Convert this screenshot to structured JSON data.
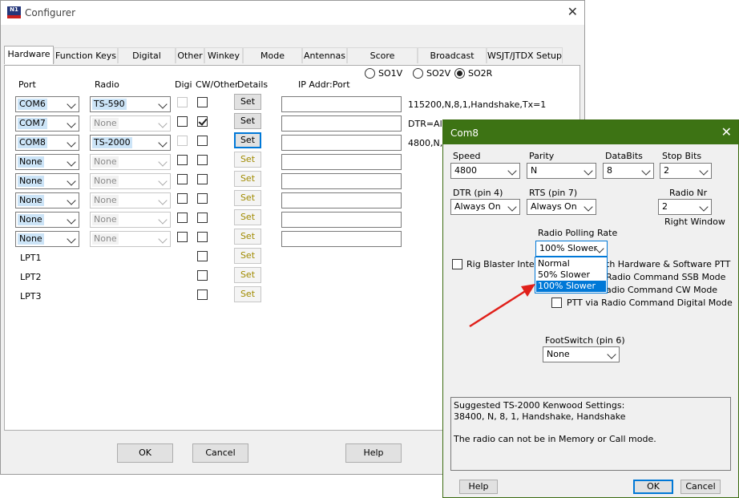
{
  "main_window": {
    "title": "Configurer",
    "tabs": [
      "Hardware",
      "Function Keys",
      "Digital Modes",
      "Other",
      "Winkey",
      "Mode Control",
      "Antennas",
      "Score Reporting",
      "Broadcast Data",
      "WSJT/JTDX Setup"
    ],
    "active_tab": "Hardware",
    "so_options": [
      "SO1V",
      "SO2V",
      "SO2R"
    ],
    "so_selected": "SO2R",
    "headers": {
      "port": "Port",
      "radio": "Radio",
      "digi": "Digi",
      "cw_other": "CW/Other",
      "details": "Details",
      "ip_addr": "IP Addr:Port"
    },
    "rows": [
      {
        "port": "COM6",
        "radio": "TS-590",
        "radio_enabled": true,
        "digi_enabled": false,
        "digi": false,
        "cw": false,
        "set_enabled": true,
        "info": "115200,N,8,1,Handshake,Tx=1"
      },
      {
        "port": "COM7",
        "radio": "None",
        "radio_enabled": false,
        "digi_enabled": true,
        "digi": false,
        "cw": true,
        "set_enabled": true,
        "info": "DTR=Alw"
      },
      {
        "port": "COM8",
        "radio": "TS-2000",
        "radio_enabled": true,
        "digi_enabled": false,
        "digi": false,
        "cw": false,
        "set_enabled": true,
        "set_focused": true,
        "info": "4800,N,8,"
      },
      {
        "port": "None",
        "radio": "None",
        "radio_enabled": false,
        "digi_enabled": true,
        "digi": false,
        "cw": false,
        "set_enabled": false,
        "info": ""
      },
      {
        "port": "None",
        "radio": "None",
        "radio_enabled": false,
        "digi_enabled": true,
        "digi": false,
        "cw": false,
        "set_enabled": false,
        "info": ""
      },
      {
        "port": "None",
        "radio": "None",
        "radio_enabled": false,
        "digi_enabled": true,
        "digi": false,
        "cw": false,
        "set_enabled": false,
        "info": ""
      },
      {
        "port": "None",
        "radio": "None",
        "radio_enabled": false,
        "digi_enabled": true,
        "digi": false,
        "cw": false,
        "set_enabled": false,
        "info": ""
      },
      {
        "port": "None",
        "radio": "None",
        "radio_enabled": false,
        "digi_enabled": true,
        "digi": false,
        "cw": false,
        "set_enabled": false,
        "info": ""
      }
    ],
    "lpt_rows": [
      {
        "label": "LPT1",
        "set_enabled": false
      },
      {
        "label": "LPT2",
        "set_enabled": false
      },
      {
        "label": "LPT3",
        "set_enabled": false
      }
    ],
    "set_label": "Set",
    "buttons": {
      "ok": "OK",
      "cancel": "Cancel",
      "help": "Help"
    }
  },
  "com_dialog": {
    "title": "Com8",
    "speed_label": "Speed",
    "speed_value": "4800",
    "parity_label": "Parity",
    "parity_value": "N",
    "databits_label": "DataBits",
    "databits_value": "8",
    "stopbits_label": "Stop Bits",
    "stopbits_value": "2",
    "dtr_label": "DTR (pin 4)",
    "dtr_value": "Always On",
    "rts_label": "RTS (pin 7)",
    "rts_value": "Always On",
    "radionr_label": "Radio Nr",
    "radionr_value": "2",
    "radionr_note": "Right Window",
    "polling_label": "Radio Polling Rate",
    "polling_value": "100% Slower",
    "polling_options": [
      "Normal",
      "50% Slower",
      "100% Slower"
    ],
    "polling_highlighted": 2,
    "rig_blaster_label": "Rig Blaster Interru",
    "ptt_hw_sw_label": "th Hardware & Software PTT",
    "ptt_ssb_label": "Radio Command SSB Mode",
    "ptt_cw_label": "adio Command CW Mode",
    "ptt_digital_label": "PTT via Radio Command Digital Mode",
    "footswitch_label": "FootSwitch (pin 6)",
    "footswitch_value": "None",
    "info_lines": [
      "Suggested TS-2000 Kenwood Settings:",
      "38400, N, 8, 1, Handshake, Handshake",
      "",
      "The radio can not be in Memory or Call mode."
    ],
    "buttons": {
      "help": "Help",
      "ok": "OK",
      "cancel": "Cancel"
    }
  },
  "annotation": {
    "arrow_color": "#e0201a"
  },
  "colors": {
    "dialog_title_bg": "#3d7314",
    "accent": "#0078d7"
  }
}
